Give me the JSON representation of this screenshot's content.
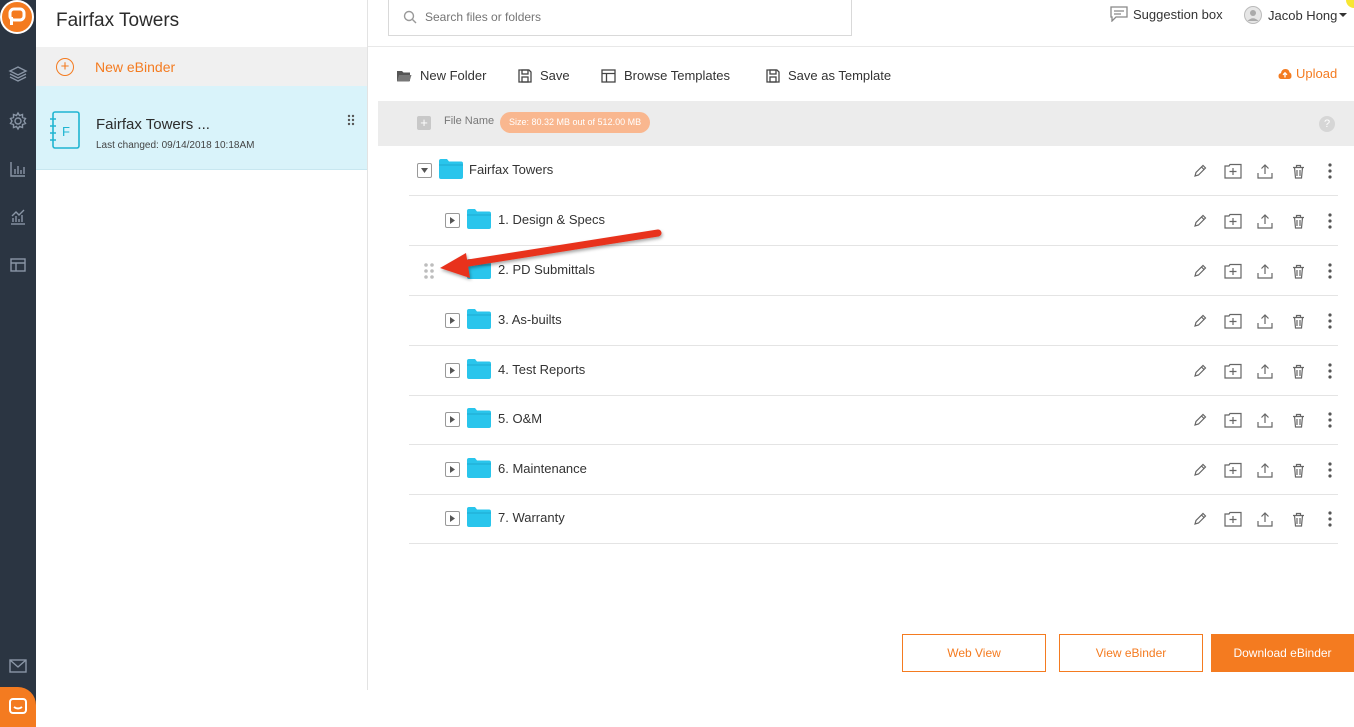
{
  "app": {
    "brand_color": "#f47b20",
    "rail_color": "#2b3542"
  },
  "binder_panel": {
    "title": "Fairfax Towers",
    "new_ebinder_label": "New eBinder",
    "binder": {
      "icon_letter": "F",
      "title": "Fairfax Towers ...",
      "last_changed": "Last changed: 09/14/2018 10:18AM"
    }
  },
  "topbar": {
    "search_placeholder": "Search files or folders",
    "suggestion_label": "Suggestion box",
    "user_name": "Jacob Hong"
  },
  "toolbar": {
    "new_folder": "New Folder",
    "save": "Save",
    "browse_templates": "Browse Templates",
    "save_as_template": "Save as Template",
    "upload": "Upload"
  },
  "file_header": {
    "label": "File Name",
    "size_badge": "Size: 80.32 MB out of 512.00 MB",
    "help": "?"
  },
  "tree": {
    "root": "Fairfax Towers",
    "folders": [
      "1. Design & Specs",
      "2. PD Submittals",
      "3. As-builts",
      "4. Test Reports",
      "5. O&M",
      "6. Maintenance",
      "7. Warranty"
    ]
  },
  "buttons": {
    "web_view": "Web View",
    "view_ebinder": "View eBinder",
    "download_ebinder": "Download eBinder"
  },
  "annotation": {
    "arrow_color": "#e8321e"
  }
}
